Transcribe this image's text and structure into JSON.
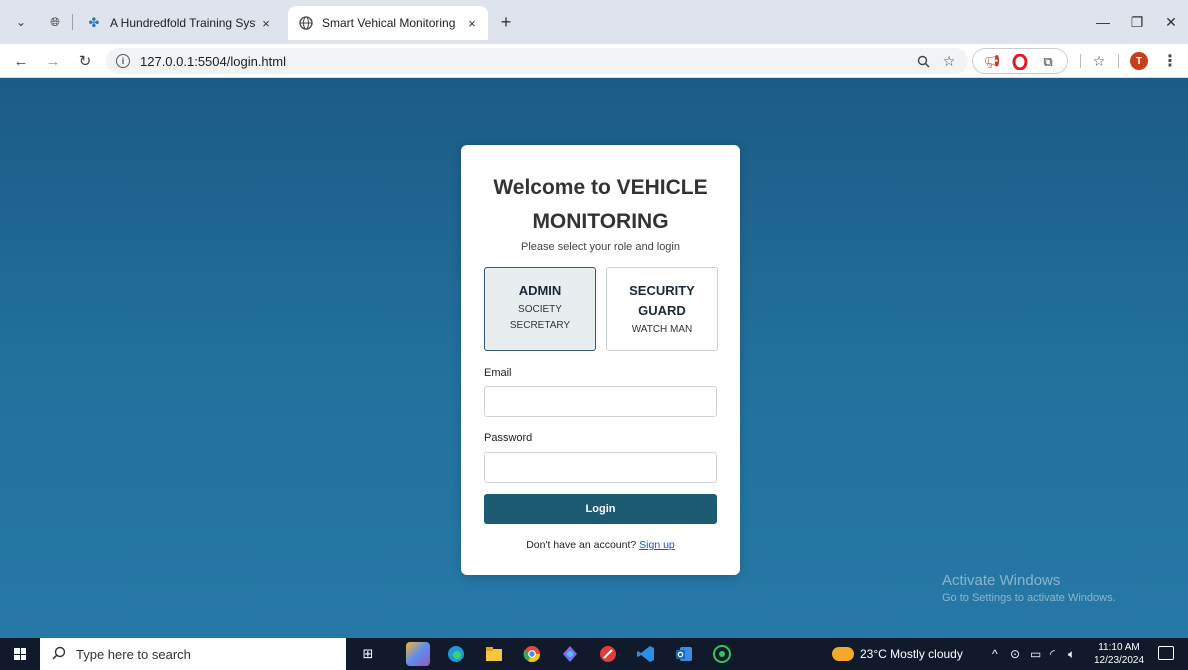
{
  "browser": {
    "tabs": [
      {
        "title": "A Hundredfold Training System",
        "close": "×"
      },
      {
        "title": "Smart Vehical Monitoring",
        "close": "×"
      }
    ],
    "new_tab": "+",
    "url": "127.0.0.1:5504/login.html",
    "profile_initial": "T"
  },
  "login": {
    "heading": "Welcome to VEHICLE MONITORING",
    "subtitle": "Please select your role and login",
    "roles": [
      {
        "title": "ADMIN",
        "sub": "SOCIETY SECRETARY",
        "selected": true
      },
      {
        "title": "SECURITY GUARD",
        "sub": "WATCH MAN",
        "selected": false
      }
    ],
    "email_label": "Email",
    "email_value": "",
    "password_label": "Password",
    "password_value": "",
    "login_button": "Login",
    "signup_prompt": "Don't have an account?",
    "signup_link": "Sign up",
    "accent_color": "#1d5b73"
  },
  "watermark": {
    "line1": "Activate Windows",
    "line2": "Go to Settings to activate Windows."
  },
  "taskbar": {
    "search_placeholder": "Type here to search",
    "weather": "23°C  Mostly cloudy",
    "time": "11:10 AM",
    "date": "12/23/2024"
  }
}
